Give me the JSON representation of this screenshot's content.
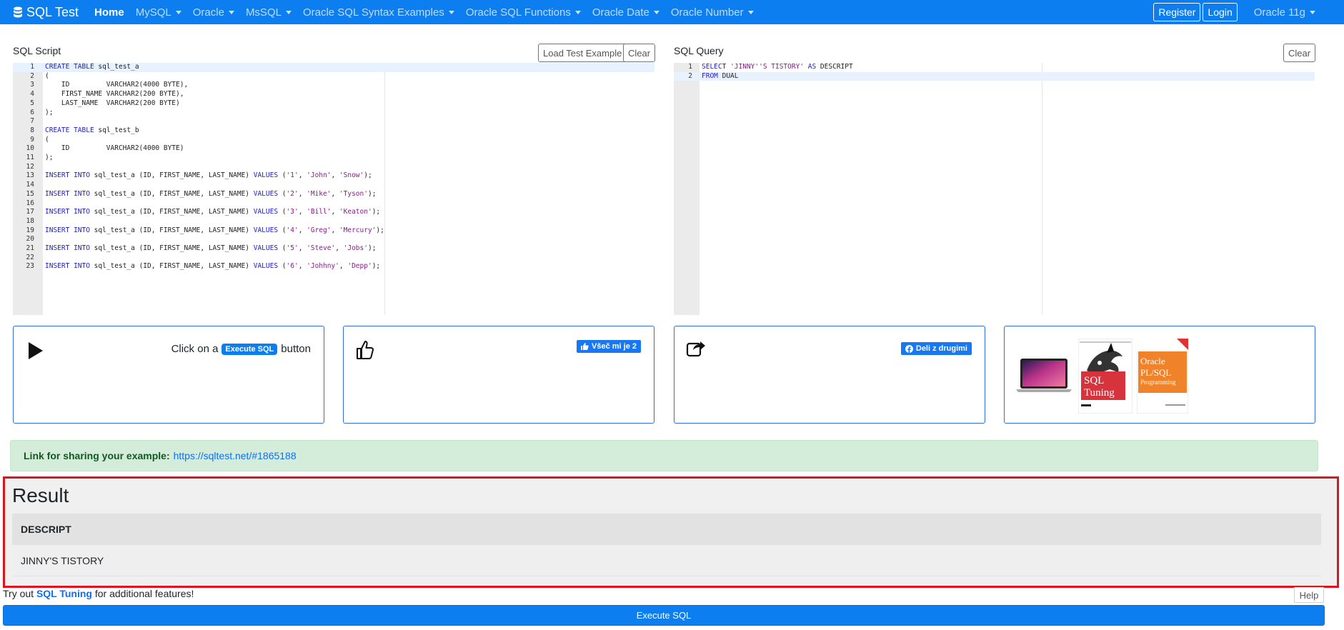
{
  "navbar": {
    "brand": "SQL Test",
    "items": [
      {
        "label": "Home",
        "dropdown": false
      },
      {
        "label": "MySQL",
        "dropdown": true
      },
      {
        "label": "Oracle",
        "dropdown": true
      },
      {
        "label": "MsSQL",
        "dropdown": true
      },
      {
        "label": "Oracle SQL Syntax Examples",
        "dropdown": true
      },
      {
        "label": "Oracle SQL Functions",
        "dropdown": true
      },
      {
        "label": "Oracle Date",
        "dropdown": true
      },
      {
        "label": "Oracle Number",
        "dropdown": true
      }
    ],
    "register": "Register",
    "login": "Login",
    "version": "Oracle 11g"
  },
  "script_panel": {
    "label": "SQL Script",
    "load_example": "Load Test Example",
    "clear": "Clear",
    "lines": [
      "CREATE TABLE sql_test_a",
      "(",
      "    ID         VARCHAR2(4000 BYTE),",
      "    FIRST_NAME VARCHAR2(200 BYTE),",
      "    LAST_NAME  VARCHAR2(200 BYTE)",
      ");",
      "",
      "CREATE TABLE sql_test_b",
      "(",
      "    ID         VARCHAR2(4000 BYTE)",
      ");",
      "",
      "INSERT INTO sql_test_a (ID, FIRST_NAME, LAST_NAME) VALUES ('1', 'John', 'Snow');",
      "",
      "INSERT INTO sql_test_a (ID, FIRST_NAME, LAST_NAME) VALUES ('2', 'Mike', 'Tyson');",
      "",
      "INSERT INTO sql_test_a (ID, FIRST_NAME, LAST_NAME) VALUES ('3', 'Bill', 'Keaton');",
      "",
      "INSERT INTO sql_test_a (ID, FIRST_NAME, LAST_NAME) VALUES ('4', 'Greg', 'Mercury');",
      "",
      "INSERT INTO sql_test_a (ID, FIRST_NAME, LAST_NAME) VALUES ('5', 'Steve', 'Jobs');",
      "",
      "INSERT INTO sql_test_a (ID, FIRST_NAME, LAST_NAME) VALUES ('6', 'Johhny', 'Depp');"
    ]
  },
  "query_panel": {
    "label": "SQL Query",
    "clear": "Clear",
    "lines": [
      "SELECT 'JINNY''S TISTORY' AS DESCRIPT",
      "FROM DUAL"
    ]
  },
  "cards": {
    "execute_prefix": "Click on a",
    "execute_badge": "Execute SQL",
    "execute_suffix": "button",
    "like_label": "Všeč mi je 2",
    "share_label": "Deli z drugimi",
    "book1_title": "SQL Tuning",
    "book2_title": "Oracle PL/SQL Programming"
  },
  "share": {
    "label": "Link for sharing your example:",
    "url": "https://sqltest.net/#1865188"
  },
  "result": {
    "title": "Result",
    "column": "DESCRIPT",
    "value": "JINNY'S TISTORY"
  },
  "footer": {
    "try_prefix": "Try out",
    "try_link": "SQL Tuning",
    "try_suffix": "for additional features!",
    "help": "Help",
    "execute": "Execute SQL"
  },
  "colors": {
    "navbar": "#0d7ef0",
    "highlight_border": "#e0141e",
    "share_bg": "#d4edda"
  }
}
